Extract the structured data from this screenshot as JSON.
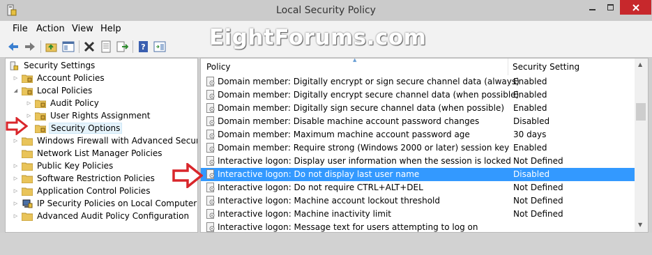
{
  "window": {
    "title": "Local Security Policy"
  },
  "menu": {
    "file": "File",
    "action": "Action",
    "view": "View",
    "help": "Help"
  },
  "watermark": "EightForums.com",
  "tree": {
    "root": "Security Settings",
    "items": [
      {
        "label": "Account Policies"
      },
      {
        "label": "Local Policies"
      },
      {
        "label": "Audit Policy"
      },
      {
        "label": "User Rights Assignment"
      },
      {
        "label": "Security Options"
      },
      {
        "label": "Windows Firewall with Advanced Security"
      },
      {
        "label": "Network List Manager Policies"
      },
      {
        "label": "Public Key Policies"
      },
      {
        "label": "Software Restriction Policies"
      },
      {
        "label": "Application Control Policies"
      },
      {
        "label": "IP Security Policies on Local Computer"
      },
      {
        "label": "Advanced Audit Policy Configuration"
      }
    ]
  },
  "list": {
    "headers": {
      "policy": "Policy",
      "setting": "Security Setting"
    },
    "rows": [
      {
        "policy": "Domain member: Digitally encrypt or sign secure channel data (always)",
        "setting": "Enabled"
      },
      {
        "policy": "Domain member: Digitally encrypt secure channel data (when possible)",
        "setting": "Enabled"
      },
      {
        "policy": "Domain member: Digitally sign secure channel data (when possible)",
        "setting": "Enabled"
      },
      {
        "policy": "Domain member: Disable machine account password changes",
        "setting": "Disabled"
      },
      {
        "policy": "Domain member: Maximum machine account password age",
        "setting": "30 days"
      },
      {
        "policy": "Domain member: Require strong (Windows 2000 or later) session key",
        "setting": "Enabled"
      },
      {
        "policy": "Interactive logon: Display user information when the session is locked",
        "setting": "Not Defined"
      },
      {
        "policy": "Interactive logon: Do not display last user name",
        "setting": "Disabled"
      },
      {
        "policy": "Interactive logon: Do not require CTRL+ALT+DEL",
        "setting": "Not Defined"
      },
      {
        "policy": "Interactive logon: Machine account lockout threshold",
        "setting": "Not Defined"
      },
      {
        "policy": "Interactive logon: Machine inactivity limit",
        "setting": "Not Defined"
      },
      {
        "policy": "Interactive logon: Message text for users attempting to log on",
        "setting": ""
      }
    ]
  },
  "colors": {
    "selection": "#3399ff",
    "arrow": "#d9262b",
    "close": "#c7282c"
  }
}
